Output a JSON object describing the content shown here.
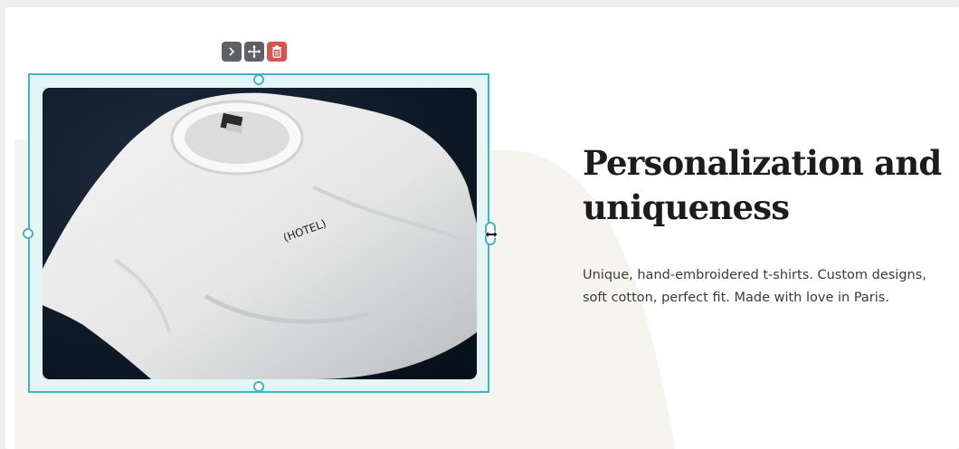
{
  "toolbar": {
    "items": [
      {
        "icon": "chevron-right-icon",
        "color": "#5d6165"
      },
      {
        "icon": "move-icon",
        "color": "#5d6165"
      },
      {
        "icon": "trash-icon",
        "color": "#d9534f"
      }
    ]
  },
  "image": {
    "alt": "White t-shirt on dark fabric",
    "embroidery_text": "(HOTEL)"
  },
  "content": {
    "heading": "Personalization and uniqueness",
    "description": "Unique, hand-embroidered t-shirts. Custom designs, soft cotton, perfect fit. Made with love in Paris."
  },
  "colors": {
    "selection": "#3fb6c8",
    "heading": "#1c1c1c",
    "background_shape": "#f5f4ef"
  }
}
